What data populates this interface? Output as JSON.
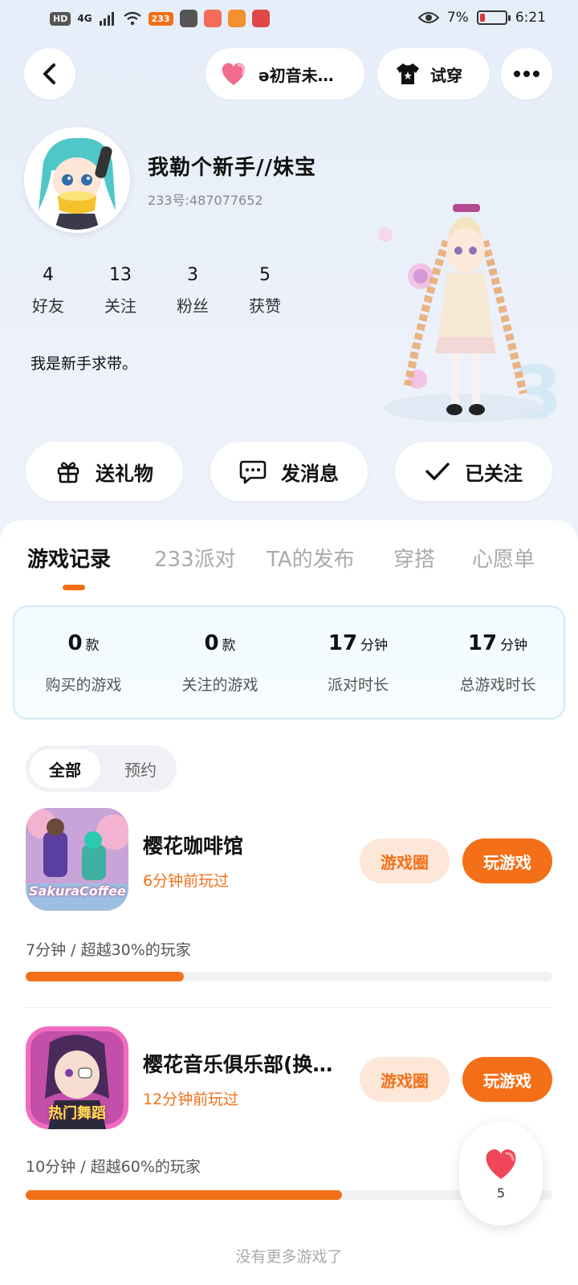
{
  "status_bar": {
    "hd": "HD",
    "network": "4G",
    "app_badge": "233",
    "battery_percent": "7%",
    "time": "6:21"
  },
  "top_bar": {
    "song_pill": "ə初音未…",
    "try_on": "试穿"
  },
  "profile": {
    "nickname": "我勒个新手//妹宝",
    "uid": "233号:487077652",
    "stats": [
      {
        "value": "4",
        "label": "好友"
      },
      {
        "value": "13",
        "label": "关注"
      },
      {
        "value": "3",
        "label": "粉丝"
      },
      {
        "value": "5",
        "label": "获赞"
      }
    ],
    "bio": "我是新手求带。"
  },
  "actions": {
    "gift": "送礼物",
    "message": "发消息",
    "followed": "已关注"
  },
  "tabs": [
    "游戏记录",
    "233派对",
    "TA的发布",
    "穿搭",
    "心愿单"
  ],
  "summary": [
    {
      "value": "0",
      "unit": "款",
      "label": "购买的游戏"
    },
    {
      "value": "0",
      "unit": "款",
      "label": "关注的游戏"
    },
    {
      "value": "17",
      "unit": "分钟",
      "label": "派对时长"
    },
    {
      "value": "17",
      "unit": "分钟",
      "label": "总游戏时长"
    }
  ],
  "filter": {
    "all": "全部",
    "reserve": "预约"
  },
  "games": [
    {
      "title": "樱花咖啡馆",
      "played": "6分钟前玩过",
      "circle_btn": "游戏圈",
      "play_btn": "玩游戏",
      "stat": "7分钟 / 超越30%的玩家",
      "progress": 0.3,
      "icon_text": "SakuraCoffee"
    },
    {
      "title": "樱花音乐俱乐部(换…",
      "played": "12分钟前玩过",
      "circle_btn": "游戏圈",
      "play_btn": "玩游戏",
      "stat": "10分钟 / 超越60%的玩家",
      "progress": 0.6,
      "icon_text": "热门舞蹈"
    }
  ],
  "likes_count": "5",
  "footer": "没有更多游戏了",
  "colors": {
    "accent": "#f36f18",
    "accent_soft": "#fde7d8",
    "heart": "#f0465a"
  }
}
